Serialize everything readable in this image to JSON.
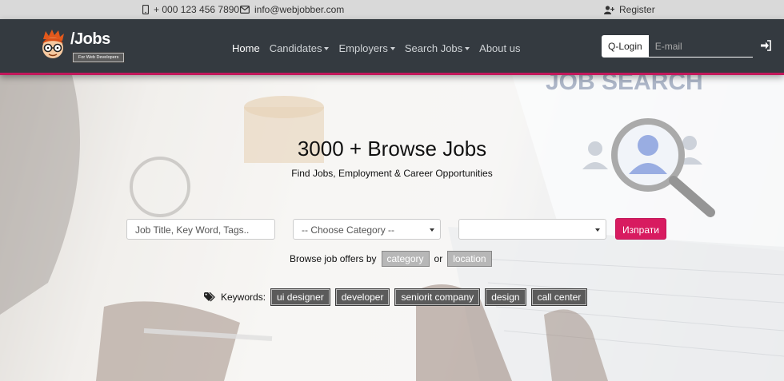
{
  "topbar": {
    "phone": "+ 000 123 456 7890",
    "email": "info@webjobber.com",
    "register": "Register"
  },
  "brand": {
    "name": "/Jobs",
    "tagline": "For Web Developers"
  },
  "nav": {
    "items": [
      {
        "label": "Home",
        "active": true,
        "dropdown": false
      },
      {
        "label": "Candidates",
        "active": false,
        "dropdown": true
      },
      {
        "label": "Employers",
        "active": false,
        "dropdown": true
      },
      {
        "label": "Search Jobs",
        "active": false,
        "dropdown": true
      },
      {
        "label": "About us",
        "active": false,
        "dropdown": false
      }
    ],
    "qlogin_label": "Q-Login",
    "email_placeholder": "E-mail"
  },
  "hero": {
    "title": "3000 + Browse Jobs",
    "subtitle": "Find Jobs, Employment & Career Opportunities",
    "background_text": "JOB SEARCH",
    "keyword_placeholder": "Job Title, Key Word, Tags..",
    "category_select": "-- Choose Category --",
    "location_select": "",
    "submit_label": "Изпрати",
    "browse_text": "Browse job offers by",
    "browse_category": "category",
    "browse_or": "or",
    "browse_location": "location",
    "keywords_label": "Keywords:",
    "keywords": [
      "ui designer",
      "developer",
      "seniorit company",
      "design",
      "call center"
    ]
  },
  "colors": {
    "nav_bg": "#343a40",
    "accent": "#d81b60",
    "topbar_bg": "#d9d9d9"
  }
}
